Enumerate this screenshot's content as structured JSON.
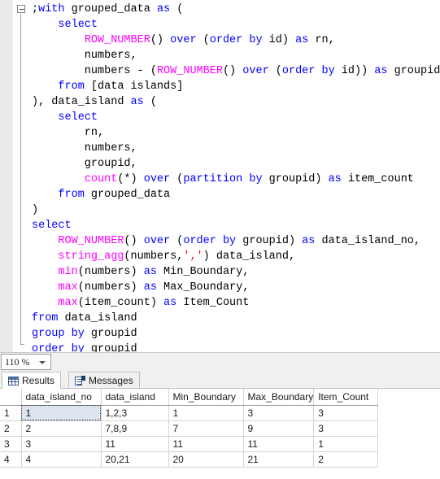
{
  "editor": {
    "zoom_level": "110 %",
    "fold_icon": "collapse-minus-icon",
    "code_lines": [
      [
        {
          "t": ";",
          "c": "pl"
        },
        {
          "t": "with",
          "c": "kw"
        },
        {
          "t": " grouped_data ",
          "c": "pl"
        },
        {
          "t": "as",
          "c": "kw"
        },
        {
          "t": " (",
          "c": "pl"
        }
      ],
      [
        {
          "t": "    ",
          "c": "pl"
        },
        {
          "t": "select",
          "c": "kw"
        }
      ],
      [
        {
          "t": "        ",
          "c": "pl"
        },
        {
          "t": "ROW_NUMBER",
          "c": "fn"
        },
        {
          "t": "() ",
          "c": "pl"
        },
        {
          "t": "over",
          "c": "kw"
        },
        {
          "t": " (",
          "c": "pl"
        },
        {
          "t": "order by",
          "c": "kw"
        },
        {
          "t": " id) ",
          "c": "pl"
        },
        {
          "t": "as",
          "c": "kw"
        },
        {
          "t": " rn,",
          "c": "pl"
        }
      ],
      [
        {
          "t": "        numbers,",
          "c": "pl"
        }
      ],
      [
        {
          "t": "        numbers - (",
          "c": "pl"
        },
        {
          "t": "ROW_NUMBER",
          "c": "fn"
        },
        {
          "t": "() ",
          "c": "pl"
        },
        {
          "t": "over",
          "c": "kw"
        },
        {
          "t": " (",
          "c": "pl"
        },
        {
          "t": "order by",
          "c": "kw"
        },
        {
          "t": " id)) ",
          "c": "pl"
        },
        {
          "t": "as",
          "c": "kw"
        },
        {
          "t": " groupid",
          "c": "pl"
        }
      ],
      [
        {
          "t": "    ",
          "c": "pl"
        },
        {
          "t": "from",
          "c": "kw"
        },
        {
          "t": " [data islands]",
          "c": "pl"
        }
      ],
      [
        {
          "t": "), data_island ",
          "c": "pl"
        },
        {
          "t": "as",
          "c": "kw"
        },
        {
          "t": " (",
          "c": "pl"
        }
      ],
      [
        {
          "t": "    ",
          "c": "pl"
        },
        {
          "t": "select",
          "c": "kw"
        }
      ],
      [
        {
          "t": "        rn,",
          "c": "pl"
        }
      ],
      [
        {
          "t": "        numbers,",
          "c": "pl"
        }
      ],
      [
        {
          "t": "        groupid,",
          "c": "pl"
        }
      ],
      [
        {
          "t": "        ",
          "c": "pl"
        },
        {
          "t": "count",
          "c": "fn"
        },
        {
          "t": "(*) ",
          "c": "pl"
        },
        {
          "t": "over",
          "c": "kw"
        },
        {
          "t": " (",
          "c": "pl"
        },
        {
          "t": "partition by",
          "c": "kw"
        },
        {
          "t": " groupid) ",
          "c": "pl"
        },
        {
          "t": "as",
          "c": "kw"
        },
        {
          "t": " item_count",
          "c": "pl"
        }
      ],
      [
        {
          "t": "    ",
          "c": "pl"
        },
        {
          "t": "from",
          "c": "kw"
        },
        {
          "t": " grouped_data",
          "c": "pl"
        }
      ],
      [
        {
          "t": ")",
          "c": "pl"
        }
      ],
      [
        {
          "t": "select",
          "c": "kw"
        }
      ],
      [
        {
          "t": "    ",
          "c": "pl"
        },
        {
          "t": "ROW_NUMBER",
          "c": "fn"
        },
        {
          "t": "() ",
          "c": "pl"
        },
        {
          "t": "over",
          "c": "kw"
        },
        {
          "t": " (",
          "c": "pl"
        },
        {
          "t": "order by",
          "c": "kw"
        },
        {
          "t": " groupid) ",
          "c": "pl"
        },
        {
          "t": "as",
          "c": "kw"
        },
        {
          "t": " data_island_no,",
          "c": "pl"
        }
      ],
      [
        {
          "t": "    ",
          "c": "pl"
        },
        {
          "t": "string_agg",
          "c": "fn"
        },
        {
          "t": "(numbers,",
          "c": "pl"
        },
        {
          "t": "','",
          "c": "str"
        },
        {
          "t": ") data_island,",
          "c": "pl"
        }
      ],
      [
        {
          "t": "    ",
          "c": "pl"
        },
        {
          "t": "min",
          "c": "fn"
        },
        {
          "t": "(numbers) ",
          "c": "pl"
        },
        {
          "t": "as",
          "c": "kw"
        },
        {
          "t": " Min_Boundary,",
          "c": "pl"
        }
      ],
      [
        {
          "t": "    ",
          "c": "pl"
        },
        {
          "t": "max",
          "c": "fn"
        },
        {
          "t": "(numbers) ",
          "c": "pl"
        },
        {
          "t": "as",
          "c": "kw"
        },
        {
          "t": " Max_Boundary,",
          "c": "pl"
        }
      ],
      [
        {
          "t": "    ",
          "c": "pl"
        },
        {
          "t": "max",
          "c": "fn"
        },
        {
          "t": "(item_count) ",
          "c": "pl"
        },
        {
          "t": "as",
          "c": "kw"
        },
        {
          "t": " Item_Count",
          "c": "pl"
        }
      ],
      [
        {
          "t": "from",
          "c": "kw"
        },
        {
          "t": " data_island",
          "c": "pl"
        }
      ],
      [
        {
          "t": "group by",
          "c": "kw"
        },
        {
          "t": " groupid",
          "c": "pl"
        }
      ],
      [
        {
          "t": "order by",
          "c": "kw"
        },
        {
          "t": " groupid",
          "c": "pl"
        }
      ]
    ],
    "colors": {
      "keyword": "#0000ff",
      "function": "#ff00ff",
      "string": "#ff0000",
      "plain": "#000000"
    }
  },
  "results_pane": {
    "tabs": [
      {
        "label": "Results",
        "icon": "grid-icon",
        "active": true
      },
      {
        "label": "Messages",
        "icon": "message-icon",
        "active": false
      }
    ],
    "grid": {
      "columns": [
        "data_island_no",
        "data_island",
        "Min_Boundary",
        "Max_Boundary",
        "Item_Count"
      ],
      "rows": [
        {
          "n": "1",
          "cells": [
            "1",
            "1,2,3",
            "1",
            "3",
            "3"
          ]
        },
        {
          "n": "2",
          "cells": [
            "2",
            "7,8,9",
            "7",
            "9",
            "3"
          ]
        },
        {
          "n": "3",
          "cells": [
            "3",
            "11",
            "11",
            "11",
            "1"
          ]
        },
        {
          "n": "4",
          "cells": [
            "4",
            "20,21",
            "20",
            "21",
            "2"
          ]
        }
      ],
      "selected_cell": {
        "row": 0,
        "col": 0
      }
    }
  }
}
